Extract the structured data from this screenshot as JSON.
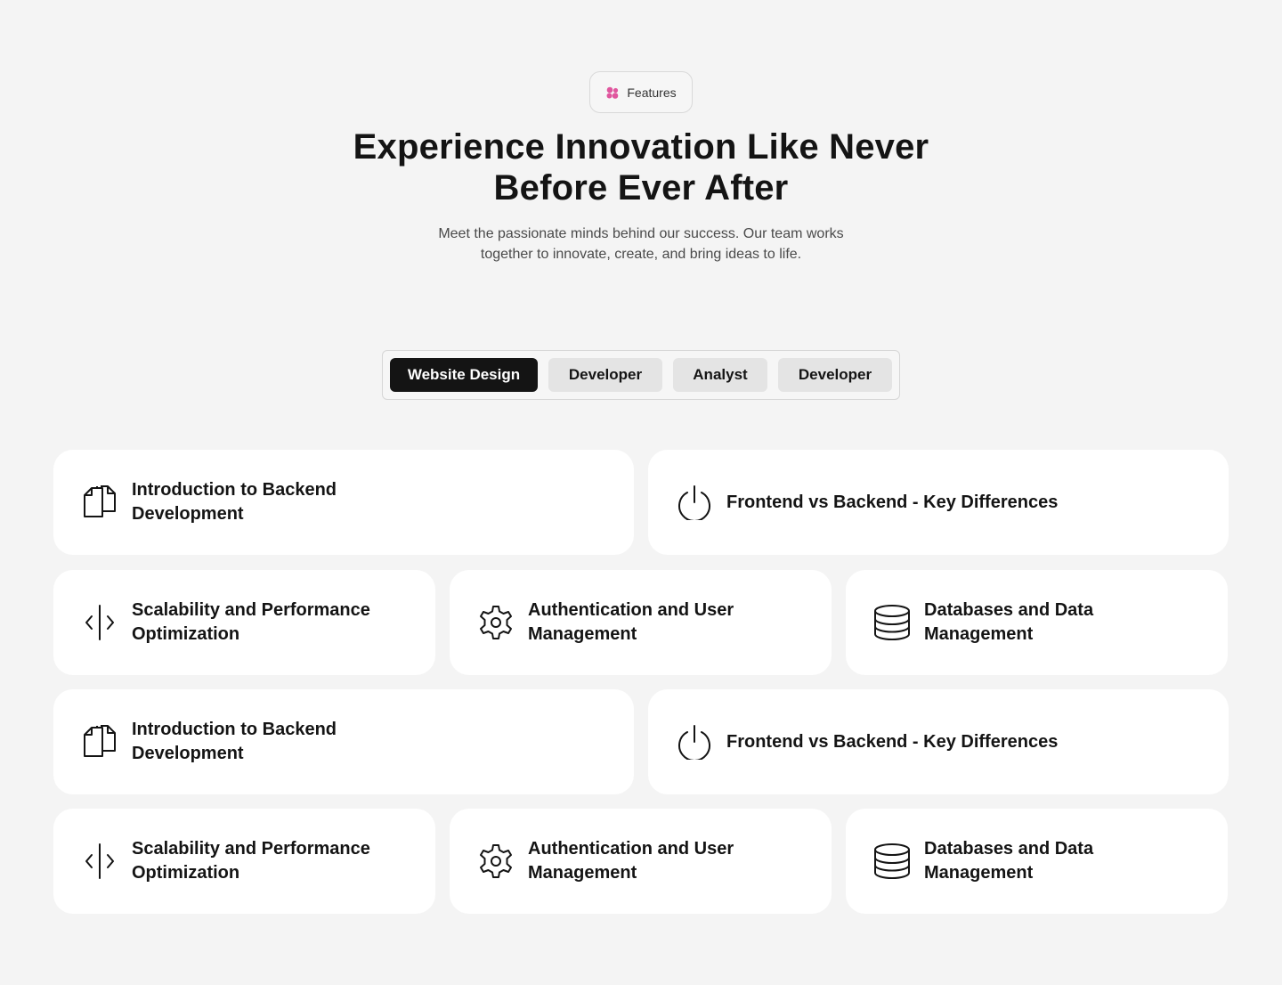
{
  "header": {
    "badge_label": "Features",
    "title_line1": "Experience Innovation Like Never",
    "title_line2": "Before Ever After",
    "subtitle_line1": "Meet the passionate minds behind our success. Our team works",
    "subtitle_line2": "together to innovate, create, and bring ideas to life."
  },
  "tabs": [
    {
      "label": "Website Design",
      "active": true
    },
    {
      "label": "Developer",
      "active": false
    },
    {
      "label": "Analyst",
      "active": false
    },
    {
      "label": "Developer",
      "active": false
    }
  ],
  "cards": [
    {
      "icon": "document-icon",
      "line1": "Introduction to Backend",
      "line2": "Development"
    },
    {
      "icon": "power-icon",
      "line1": "Frontend vs Backend - Key Differences",
      "line2": ""
    },
    {
      "icon": "code-split-icon",
      "line1": "Scalability and Performance",
      "line2": "Optimization"
    },
    {
      "icon": "gear-icon",
      "line1": "Authentication and User",
      "line2": "Management"
    },
    {
      "icon": "database-icon",
      "line1": "Databases and Data",
      "line2": "Management"
    },
    {
      "icon": "document-icon",
      "line1": "Introduction to Backend",
      "line2": "Development"
    },
    {
      "icon": "power-icon",
      "line1": "Frontend vs Backend - Key Differences",
      "line2": ""
    },
    {
      "icon": "code-split-icon",
      "line1": "Scalability and Performance",
      "line2": "Optimization"
    },
    {
      "icon": "gear-icon",
      "line1": "Authentication and User",
      "line2": "Management"
    },
    {
      "icon": "database-icon",
      "line1": "Databases and Data",
      "line2": "Management"
    }
  ],
  "colors": {
    "background": "#f4f4f4",
    "accent": "#e0569e",
    "active_tab": "#141414",
    "inactive_tab": "#e4e4e4",
    "card": "#ffffff"
  }
}
